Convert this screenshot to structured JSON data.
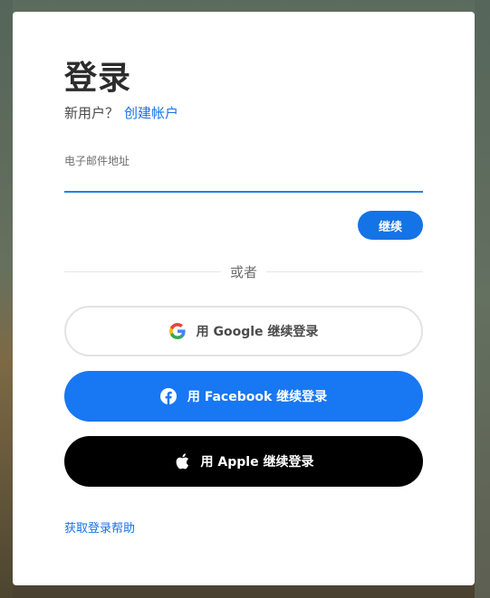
{
  "login": {
    "title": "登录",
    "new_user_prompt": "新用户？",
    "create_account_link": "创建帐户",
    "email_label": "电子邮件地址",
    "email_value": "",
    "continue_label": "继续",
    "divider_text": "或者",
    "google_label": "用 Google 继续登录",
    "facebook_label": "用 Facebook 继续登录",
    "apple_label": "用 Apple 继续登录",
    "help_link": "获取登录帮助"
  },
  "colors": {
    "accent": "#1473e6",
    "facebook": "#1877f2",
    "apple": "#000000"
  },
  "icons": {
    "google": "google-icon",
    "facebook": "facebook-icon",
    "apple": "apple-icon"
  }
}
